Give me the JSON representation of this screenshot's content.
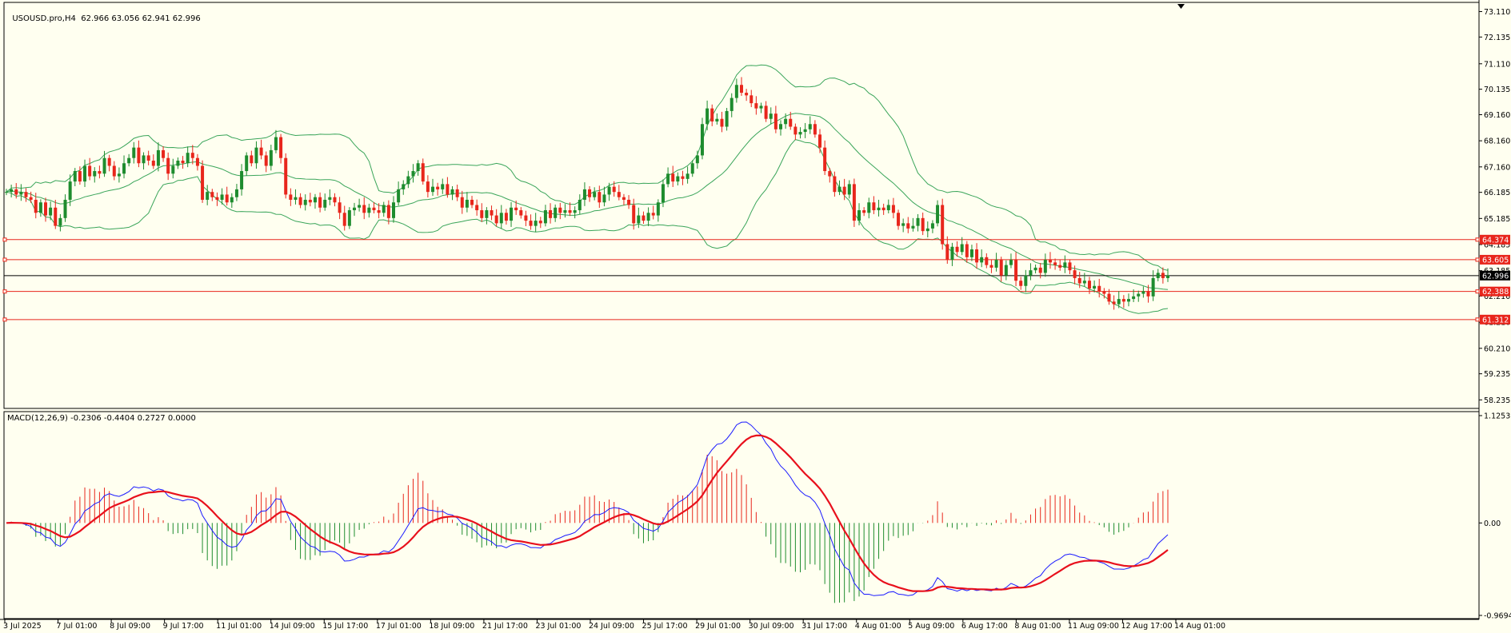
{
  "header": {
    "symbol": "USOUSD.pro,H4",
    "ohlc": "62.966 63.056 62.941 62.996"
  },
  "macd": {
    "label": "MACD(12,26,9) -0.2306 -0.4404 0.2727 0.0000",
    "ticks": [
      "1.1253",
      "0.00",
      "-0.9694"
    ]
  },
  "price_axis": {
    "ticks": [
      "73.110",
      "72.135",
      "71.110",
      "70.135",
      "69.160",
      "68.160",
      "67.160",
      "66.185",
      "65.185",
      "64.185",
      "63.185",
      "62.210",
      "61.210",
      "60.210",
      "59.235",
      "58.235"
    ]
  },
  "time_axis": {
    "labels": [
      "3 Jul 2025",
      "7 Jul 01:00",
      "8 Jul 09:00",
      "9 Jul 17:00",
      "11 Jul 01:00",
      "14 Jul 09:00",
      "15 Jul 17:00",
      "17 Jul 01:00",
      "18 Jul 09:00",
      "21 Jul 17:00",
      "23 Jul 01:00",
      "24 Jul 09:00",
      "25 Jul 17:00",
      "29 Jul 01:00",
      "30 Jul 09:00",
      "31 Jul 17:00",
      "4 Aug 01:00",
      "5 Aug 09:00",
      "6 Aug 17:00",
      "8 Aug 01:00",
      "11 Aug 09:00",
      "12 Aug 17:00",
      "14 Aug 01:00"
    ]
  },
  "levels": [
    {
      "label": "64.374",
      "color": "#e8261c"
    },
    {
      "label": "63.605",
      "color": "#e8261c"
    },
    {
      "label": "62.996",
      "color": "#000000"
    },
    {
      "label": "62.388",
      "color": "#e8261c"
    },
    {
      "label": "61.312",
      "color": "#e8261c"
    }
  ],
  "colors": {
    "bull": "#1e8c2e",
    "bear": "#e8261c",
    "bands": "#3aa55a",
    "macd_line": "#1a1aff",
    "signal_line": "#e8101c",
    "background": "#fffff0"
  },
  "chart_data": [
    {
      "type": "candlestick",
      "title": "USOUSD.pro,H4",
      "ylim": [
        58.0,
        73.4
      ],
      "closes": [
        66.2,
        66.3,
        66.1,
        66.2,
        66.0,
        65.9,
        65.4,
        65.8,
        65.3,
        65.6,
        64.9,
        65.2,
        65.9,
        66.6,
        67.0,
        66.6,
        67.2,
        66.8,
        67.0,
        66.9,
        67.5,
        67.2,
        66.8,
        66.9,
        67.3,
        67.5,
        67.9,
        67.3,
        67.6,
        67.4,
        67.2,
        67.8,
        67.5,
        66.9,
        67.2,
        67.4,
        67.3,
        67.7,
        67.5,
        67.2,
        65.9,
        66.2,
        66.0,
        65.9,
        66.1,
        65.8,
        66.0,
        66.3,
        67.0,
        67.6,
        67.3,
        67.9,
        67.6,
        67.2,
        67.8,
        68.3,
        67.5,
        66.1,
        65.9,
        66.0,
        65.7,
        65.9,
        65.8,
        66.0,
        65.6,
        65.9,
        66.0,
        65.8,
        65.4,
        64.9,
        65.5,
        65.6,
        65.7,
        65.4,
        65.6,
        65.5,
        65.4,
        65.7,
        65.2,
        65.8,
        66.3,
        66.5,
        66.8,
        67.0,
        67.3,
        66.6,
        66.2,
        66.4,
        66.3,
        66.5,
        66.1,
        66.3,
        66.0,
        65.6,
        65.9,
        65.7,
        65.5,
        65.2,
        65.5,
        65.3,
        65.0,
        65.4,
        65.1,
        65.6,
        65.5,
        65.3,
        65.1,
        64.9,
        65.1,
        65.0,
        65.5,
        65.2,
        65.6,
        65.4,
        65.5,
        65.4,
        65.5,
        65.9,
        66.3,
        66.0,
        66.2,
        65.8,
        66.1,
        66.4,
        66.2,
        66.0,
        65.9,
        65.7,
        65.0,
        65.3,
        65.1,
        65.4,
        65.3,
        65.8,
        66.5,
        66.9,
        66.6,
        66.8,
        66.7,
        66.9,
        67.3,
        67.6,
        68.8,
        69.4,
        68.9,
        69.0,
        68.7,
        69.3,
        69.8,
        70.3,
        70.0,
        69.9,
        69.6,
        69.4,
        69.5,
        69.0,
        69.2,
        68.6,
        68.8,
        69.0,
        68.7,
        68.4,
        68.5,
        68.6,
        68.8,
        68.4,
        67.9,
        67.0,
        66.8,
        66.2,
        66.4,
        66.1,
        66.5,
        65.1,
        65.5,
        65.4,
        65.8,
        65.5,
        65.6,
        65.5,
        65.7,
        65.4,
        64.9,
        65.0,
        64.8,
        64.9,
        65.2,
        64.7,
        64.8,
        65.0,
        65.7,
        64.2,
        63.6,
        64.1,
        63.9,
        64.2,
        63.7,
        64.0,
        63.5,
        63.7,
        63.4,
        63.3,
        63.6,
        63.0,
        63.4,
        63.6,
        62.8,
        62.6,
        63.0,
        63.2,
        63.3,
        63.1,
        63.6,
        63.5,
        63.4,
        63.3,
        63.5,
        63.2,
        62.9,
        62.7,
        62.8,
        62.5,
        62.6,
        62.4,
        62.3,
        62.0,
        61.9,
        62.1,
        62.0,
        62.1,
        62.2,
        62.3,
        62.4,
        62.2,
        62.9,
        63.1,
        62.9,
        63.0
      ],
      "series": [
        {
          "name": "MA",
          "type": "line"
        },
        {
          "name": "Upper Band",
          "type": "line"
        },
        {
          "name": "Lower Band",
          "type": "line"
        }
      ],
      "xlabel": "",
      "ylabel": ""
    },
    {
      "type": "line",
      "title": "MACD(12,26,9)",
      "ylim": [
        -0.9694,
        1.1253
      ],
      "series": [
        {
          "name": "Histogram",
          "type": "bar"
        },
        {
          "name": "MACD",
          "type": "line"
        },
        {
          "name": "Signal",
          "type": "line"
        }
      ]
    }
  ]
}
